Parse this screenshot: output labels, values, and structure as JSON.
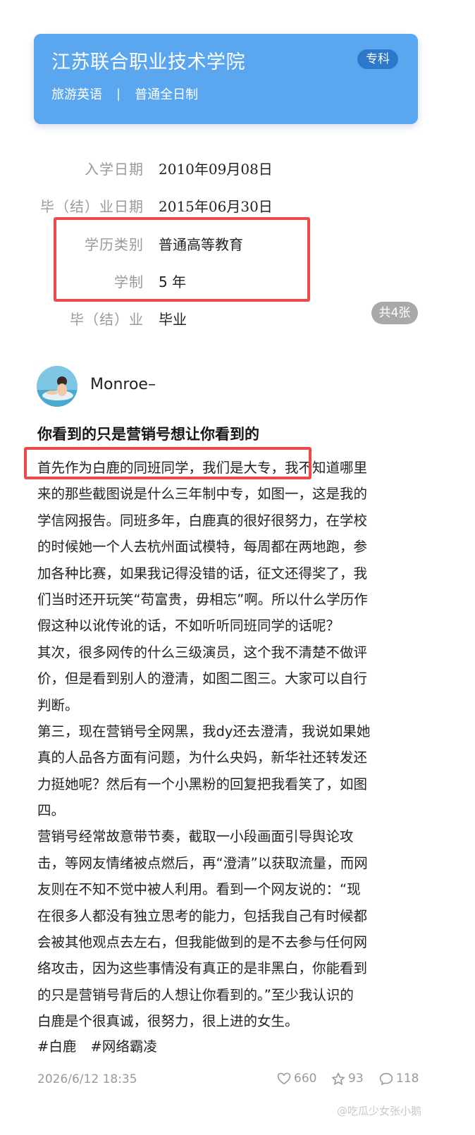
{
  "certificate": {
    "school": "江苏联合职业技术学院",
    "badge": "专科",
    "major": "旅游英语",
    "separator": "|",
    "study_mode": "普通全日制",
    "card_color": "#5aa6ef"
  },
  "info_rows": [
    {
      "label": "入学日期",
      "value": "2010年09月08日"
    },
    {
      "label": "毕（结）业日期",
      "value": "2015年06月30日"
    },
    {
      "label": "学历类别",
      "value": "普通高等教育"
    },
    {
      "label": "学制",
      "value": "5 年"
    },
    {
      "label": "毕（结）业",
      "value": "毕业"
    }
  ],
  "image_count": "共4张",
  "post": {
    "username": "Monroe–",
    "title": "你看到的只是营销号想让你看到的",
    "lines": [
      "首先作为白鹿的同班同学，我们是大专，我不知道哪里",
      "来的那些截图说是什么三年制中专，如图一，这是我的",
      "学信网报告。同班多年，白鹿真的很好很努力，在学校",
      "的时候她一个人去杭州面试模特，每周都在两地跑，参",
      "加各种比赛，如果我记得没错的话，征文还得奖了，我",
      "们当时还开玩笑“苟富贵，毋相忘”啊。所以什么学历作",
      "假这种以讹传讹的话，不如听听同班同学的话呢？",
      "其次，很多网传的什么三级演员，这个我不清楚不做评",
      "价，但是看到别人的澄清，如图二图三。大家可以自行",
      "判断。",
      "第三，现在营销号全网黑，我dy还去澄清，我说如果她",
      "真的人品各方面有问题，为什么央妈，新华社还转发还",
      "力挺她呢？然后有一个小黑粉的回复把我看笑了，如图",
      "四。",
      "营销号经常故意带节奏，截取一小段画面引导舆论攻",
      "击，等网友情绪被点燃后，再“澄清”以获取流量，而网",
      "友则在不知不觉中被人利用。看到一个网友说的：“现",
      "在很多人都没有独立思考的能力，包括我自己有时候都",
      "会被其他观点去左右，但我能做到的是不去参与任何网",
      "络攻击，因为这些事情没有真正的是非黑白，你能看到",
      "的只是营销号背后的人想让你看到的。”至少我认识的",
      "白鹿是个很真诚，很努力，很上进的女生。"
    ],
    "tags": [
      "#白鹿",
      "#网络霸凌"
    ],
    "date": "2026/6/12 18:35",
    "likes": "660",
    "favorites": "93",
    "comments": "118"
  },
  "watermark": "@吃瓜少女张小鹅",
  "highlight_color": "#ec4a4a"
}
